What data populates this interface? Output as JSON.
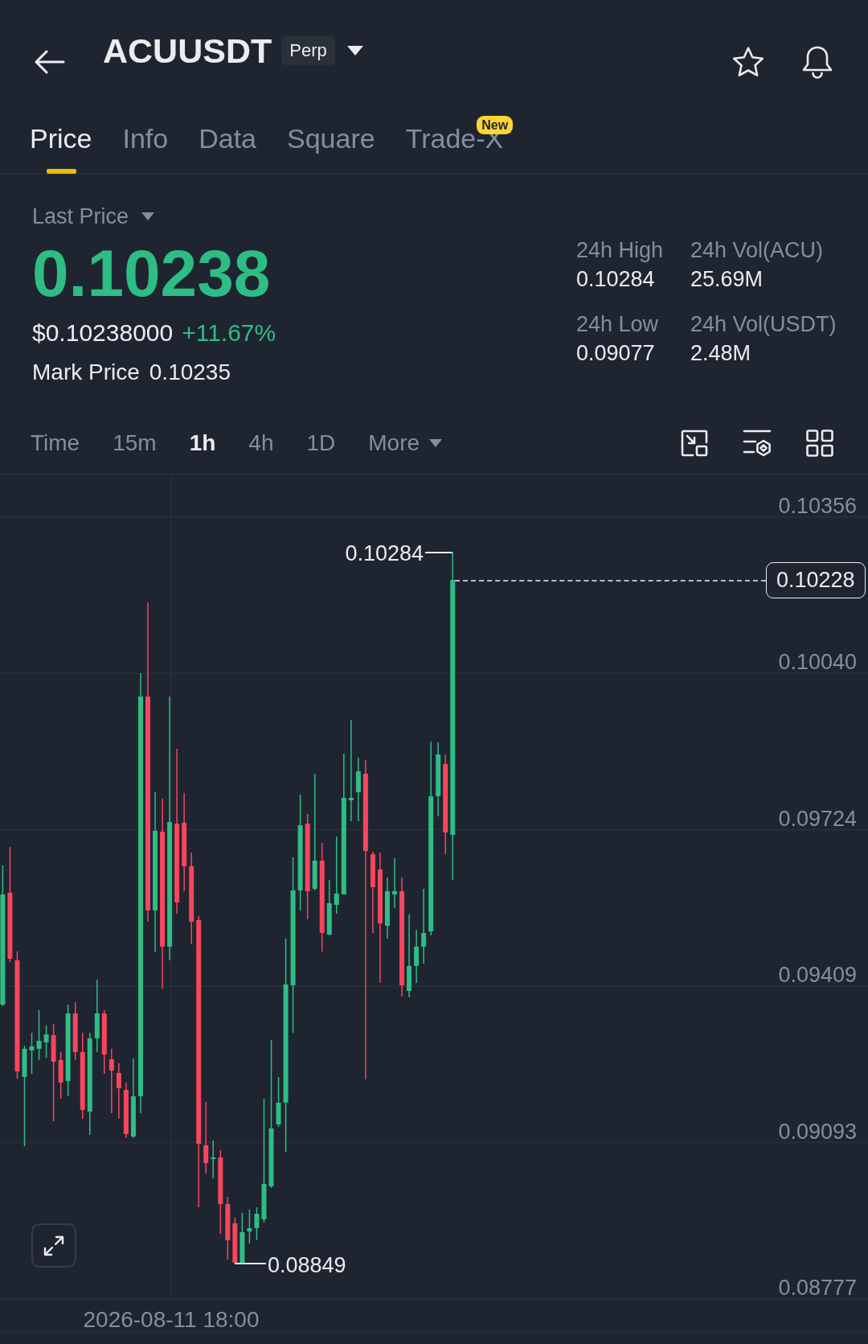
{
  "header": {
    "symbol": "ACUUSDT",
    "badge": "Perp"
  },
  "tabs": [
    {
      "label": "Price",
      "selected": true
    },
    {
      "label": "Info",
      "selected": false
    },
    {
      "label": "Data",
      "selected": false
    },
    {
      "label": "Square",
      "selected": false
    },
    {
      "label": "Trade-X",
      "selected": false,
      "badge": "New"
    }
  ],
  "price": {
    "type_label": "Last Price",
    "value": "0.10238",
    "rising": true,
    "usd": "$0.10238000",
    "change": "+11.67%",
    "mark_label": "Mark Price",
    "mark_value": "0.10235"
  },
  "stats": [
    {
      "label": "24h High",
      "value": "0.10284"
    },
    {
      "label": "24h Vol(ACU)",
      "value": "25.69M"
    },
    {
      "label": "24h Low",
      "value": "0.09077"
    },
    {
      "label": "24h Vol(USDT)",
      "value": "2.48M"
    }
  ],
  "intervals": [
    {
      "label": "Time",
      "selected": false,
      "kind": "interval"
    },
    {
      "label": "15m",
      "selected": false,
      "kind": "interval"
    },
    {
      "label": "1h",
      "selected": true,
      "kind": "interval"
    },
    {
      "label": "4h",
      "selected": false,
      "kind": "interval"
    },
    {
      "label": "1D",
      "selected": false,
      "kind": "interval"
    },
    {
      "label": "More",
      "selected": false,
      "kind": "dropdown"
    }
  ],
  "chart": {
    "price_axis": [
      "0.10356",
      "0.10040",
      "0.09724",
      "0.09409",
      "0.09093",
      "0.08777"
    ],
    "high_label": "0.10284",
    "low_label": "0.08849",
    "current_price": "0.10228",
    "time_axis": [
      "2026-08-11 18:00"
    ]
  }
}
